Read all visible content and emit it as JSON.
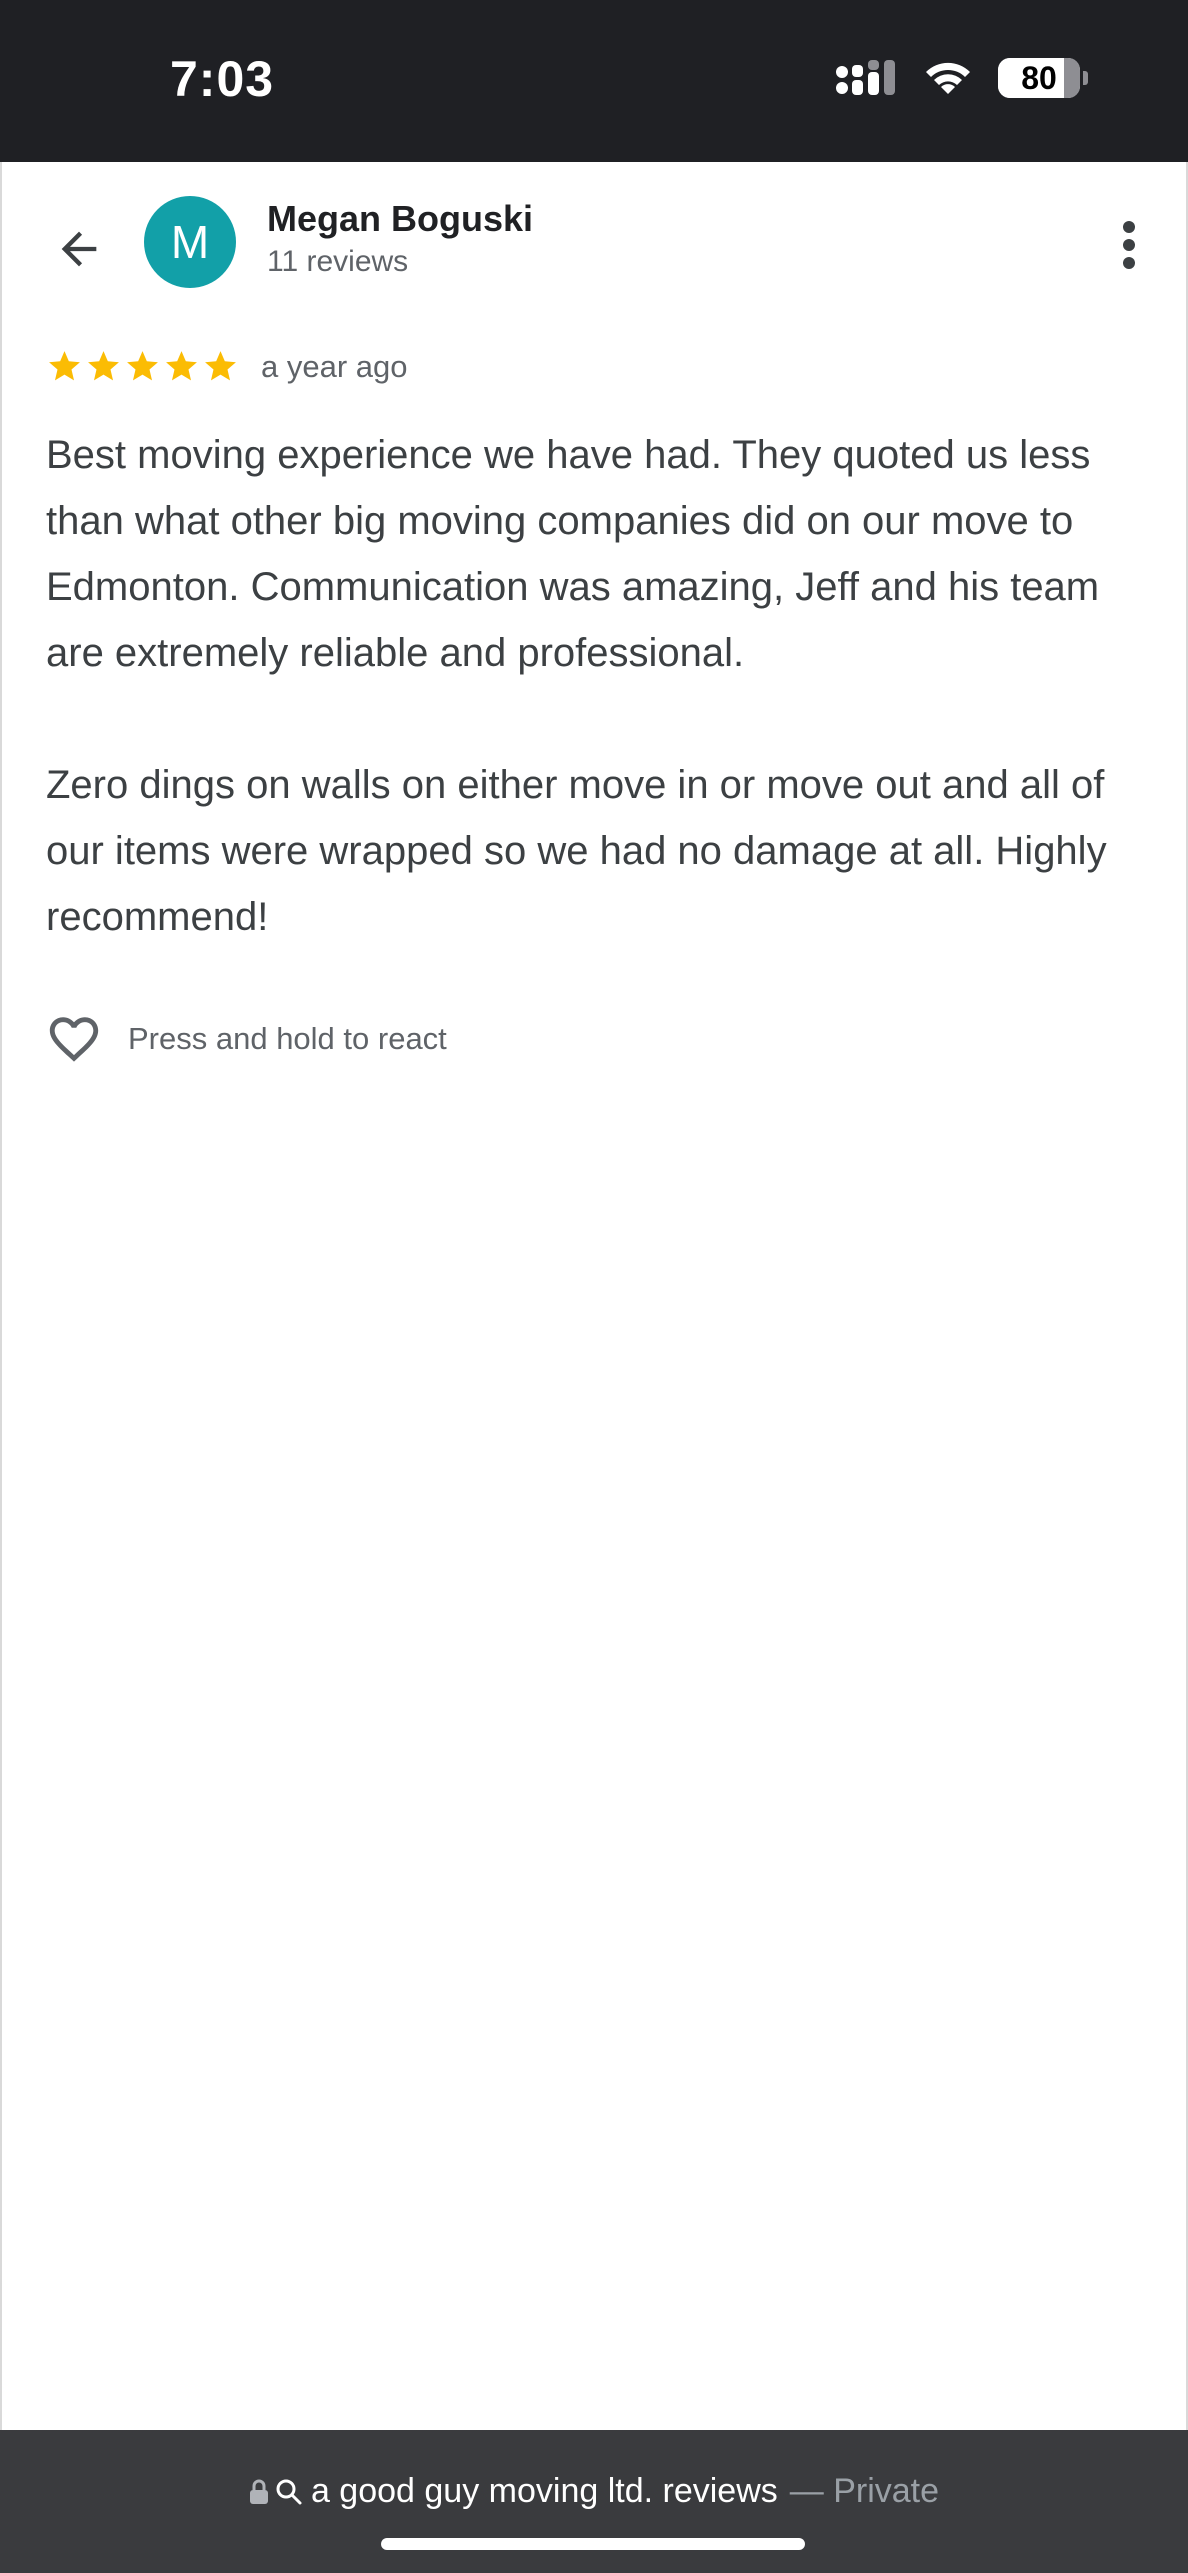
{
  "status_bar": {
    "time": "7:03",
    "battery_level": "80",
    "battery_fraction": 0.8,
    "icons": [
      "cellular-signal-icon",
      "wifi-icon",
      "battery-icon"
    ]
  },
  "header": {
    "back_icon": "arrow-back-icon",
    "avatar_initial": "M",
    "avatar_color": "#12a0a8",
    "reviewer_name": "Megan Boguski",
    "review_count": "11 reviews",
    "menu_icon": "more-vertical-icon"
  },
  "review": {
    "rating": 5,
    "rating_max": 5,
    "star_color": "#fbbc04",
    "time_ago": "a year ago",
    "text": "Best moving experience we have had. They quoted us less than what other big moving companies did on our move to Edmonton. Communication was amazing, Jeff and his team are extremely reliable and professional.\n\nZero dings on walls on either move in or move out and all of our items were wrapped so we had no damage at all. Highly recommend!"
  },
  "react": {
    "icon": "heart-outline-icon",
    "label": "Press and hold to react"
  },
  "browser_bar": {
    "address": "a good guy moving ltd. reviews",
    "private_label": "— Private",
    "icons": [
      "lock-icon",
      "search-icon"
    ]
  }
}
